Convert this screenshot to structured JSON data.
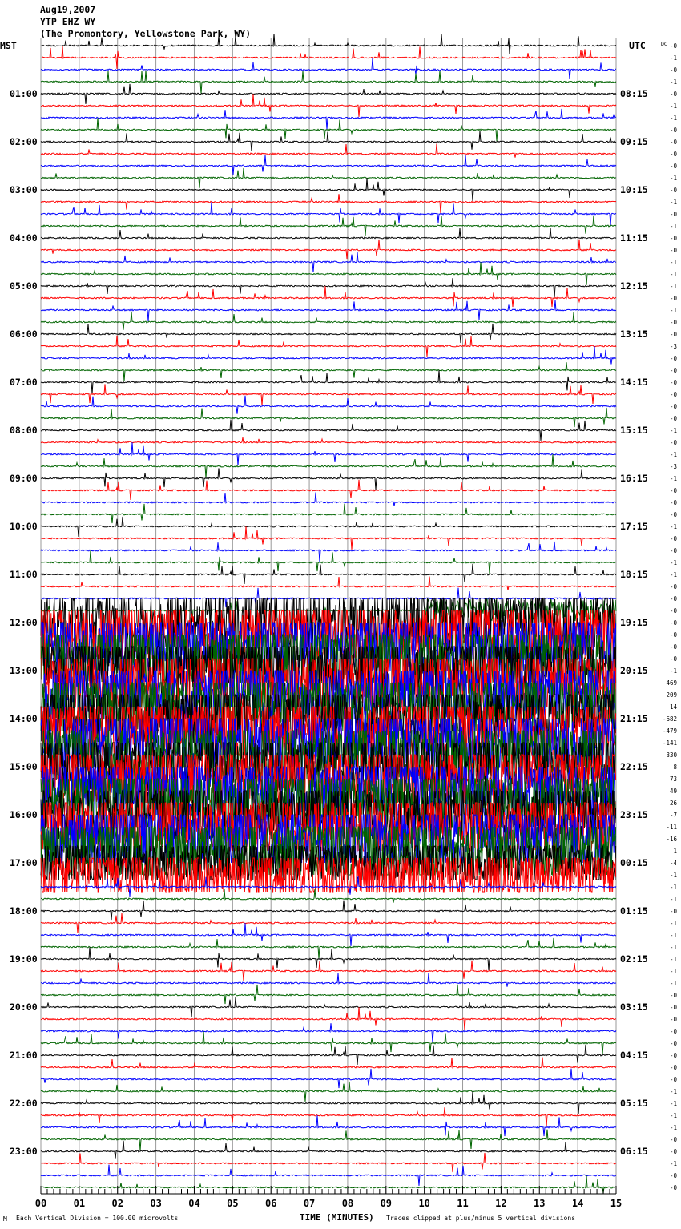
{
  "header": {
    "date": "Aug19,2007",
    "station": "YTP EHZ WY",
    "location": "(The Promontory, Yellowstone Park, WY)"
  },
  "chart_data": {
    "type": "line",
    "subtype": "helicorder",
    "left_axis_title": "MST",
    "right_axis_title": "UTC",
    "dc_header": "DC",
    "minutes_per_trace": 15,
    "traces_per_hour": 4,
    "trace_colors": [
      "#000000",
      "#ff0000",
      "#0000ff",
      "#006400"
    ],
    "mst_hour_labels": [
      "01:00",
      "02:00",
      "03:00",
      "04:00",
      "05:00",
      "06:00",
      "07:00",
      "08:00",
      "09:00",
      "10:00",
      "11:00",
      "12:00",
      "13:00",
      "14:00",
      "15:00",
      "16:00",
      "17:00",
      "18:00",
      "19:00",
      "20:00",
      "21:00",
      "22:00",
      "23:00"
    ],
    "utc_hour_labels": [
      "08:15",
      "09:15",
      "10:15",
      "11:15",
      "12:15",
      "13:15",
      "14:15",
      "15:15",
      "16:15",
      "17:15",
      "18:15",
      "19:15",
      "20:15",
      "21:15",
      "22:15",
      "23:15",
      "00:15",
      "01:15",
      "02:15",
      "03:15",
      "04:15",
      "05:15",
      "06:15"
    ],
    "dc_offsets": [
      "-0",
      "-1",
      "-0",
      "-1",
      "-0",
      "-1",
      "-1",
      "-0",
      "-0",
      "-0",
      "-0",
      "-1",
      "-0",
      "-1",
      "-0",
      "-1",
      "-0",
      "-0",
      "-1",
      "-1",
      "-1",
      "-0",
      "-1",
      "-0",
      "-0",
      "-3",
      "-0",
      "-0",
      "-0",
      "-0",
      "-0",
      "-0",
      "-1",
      "-0",
      "-1",
      "-3",
      "-1",
      "-0",
      "-0",
      "-0",
      "-1",
      "-0",
      "-0",
      "-1",
      "-1",
      "-0",
      "-0",
      "-0",
      "-0",
      "-0",
      "-0",
      "-0",
      "-1",
      "469",
      "209",
      "14",
      "-682",
      "-479",
      "-141",
      "330",
      "8",
      "73",
      "49",
      "26",
      "-7",
      "-11",
      "-16",
      "1",
      "-4",
      "-1",
      "-1",
      "-1",
      "-0",
      "-1",
      "-1",
      "-1",
      "-1",
      "-1",
      "-1",
      "-0",
      "-0",
      "-0",
      "-0",
      "-0",
      "-0",
      "-0",
      "-0",
      "-1",
      "-1",
      "-1",
      "-1",
      "-0",
      "-0",
      "-1",
      "-0",
      "-0"
    ],
    "x_ticks": [
      "00",
      "01",
      "02",
      "03",
      "04",
      "05",
      "06",
      "07",
      "08",
      "09",
      "10",
      "11",
      "12",
      "13",
      "14",
      "15"
    ],
    "xlabel": "TIME (MINUTES)",
    "xlim": [
      0,
      15
    ],
    "scale_note": "Each Vertical Division =  100.00 microvolts",
    "clip_note": "Traces clipped at plus/minus 5 vertical divisions",
    "clip_divisions": 5,
    "strong_shaking_window_mst": [
      "11:45",
      "17:30"
    ]
  }
}
